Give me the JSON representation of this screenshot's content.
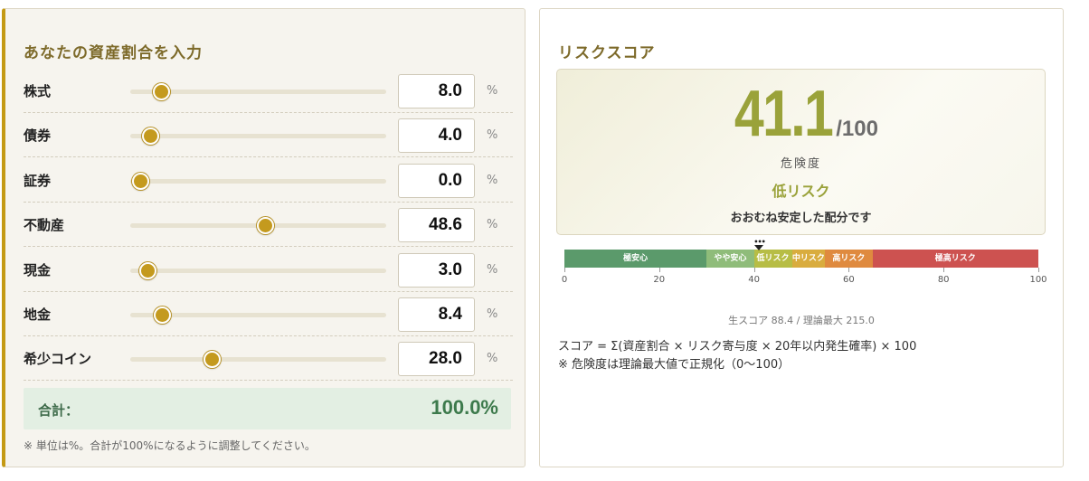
{
  "left": {
    "title": "あなたの資産割合を入力",
    "unit": "%",
    "assets": [
      {
        "label": "株式",
        "value": "8.0",
        "level": 8.0
      },
      {
        "label": "債券",
        "value": "4.0",
        "level": 4.0
      },
      {
        "label": "証券",
        "value": "0.0",
        "level": 0.0
      },
      {
        "label": "不動産",
        "value": "48.6",
        "level": 48.6
      },
      {
        "label": "現金",
        "value": "3.0",
        "level": 3.0
      },
      {
        "label": "地金",
        "value": "8.4",
        "level": 8.4
      },
      {
        "label": "希少コイン",
        "value": "28.0",
        "level": 28.0
      }
    ],
    "total_label": "合計：",
    "total_value": "100.0%",
    "note": "※ 単位は%。合計が100%になるように調整してください。"
  },
  "right": {
    "title": "リスクスコア",
    "score": "41.1",
    "score_value": 41.1,
    "score_max": "/100",
    "score_label": "危険度",
    "risk_level": "低リスク",
    "risk_description": "おおむね安定した配分です",
    "gauge": {
      "segments": [
        {
          "label": "極安心",
          "from": 0,
          "to": 30,
          "color": "#5b9a6b"
        },
        {
          "label": "やや安心",
          "from": 30,
          "to": 40,
          "color": "#8fbc7a"
        },
        {
          "label": "低リスク",
          "from": 40,
          "to": 48,
          "color": "#b7bd45"
        },
        {
          "label": "中リスク",
          "from": 48,
          "to": 55,
          "color": "#d9ac3e"
        },
        {
          "label": "高リスク",
          "from": 55,
          "to": 65,
          "color": "#df8a3f"
        },
        {
          "label": "極高リスク",
          "from": 65,
          "to": 100,
          "color": "#cd5250"
        }
      ],
      "ticks": [
        "0",
        "20",
        "40",
        "60",
        "80",
        "100"
      ],
      "marker": "•••"
    },
    "raw_score": "生スコア 88.4 / 理論最大 215.0",
    "formula": "スコア = Σ(資産割合 × リスク寄与度 × 20年以内発生確率) × 100",
    "formula_note": "※ 危険度は理論最大値で正規化（0〜100）"
  }
}
